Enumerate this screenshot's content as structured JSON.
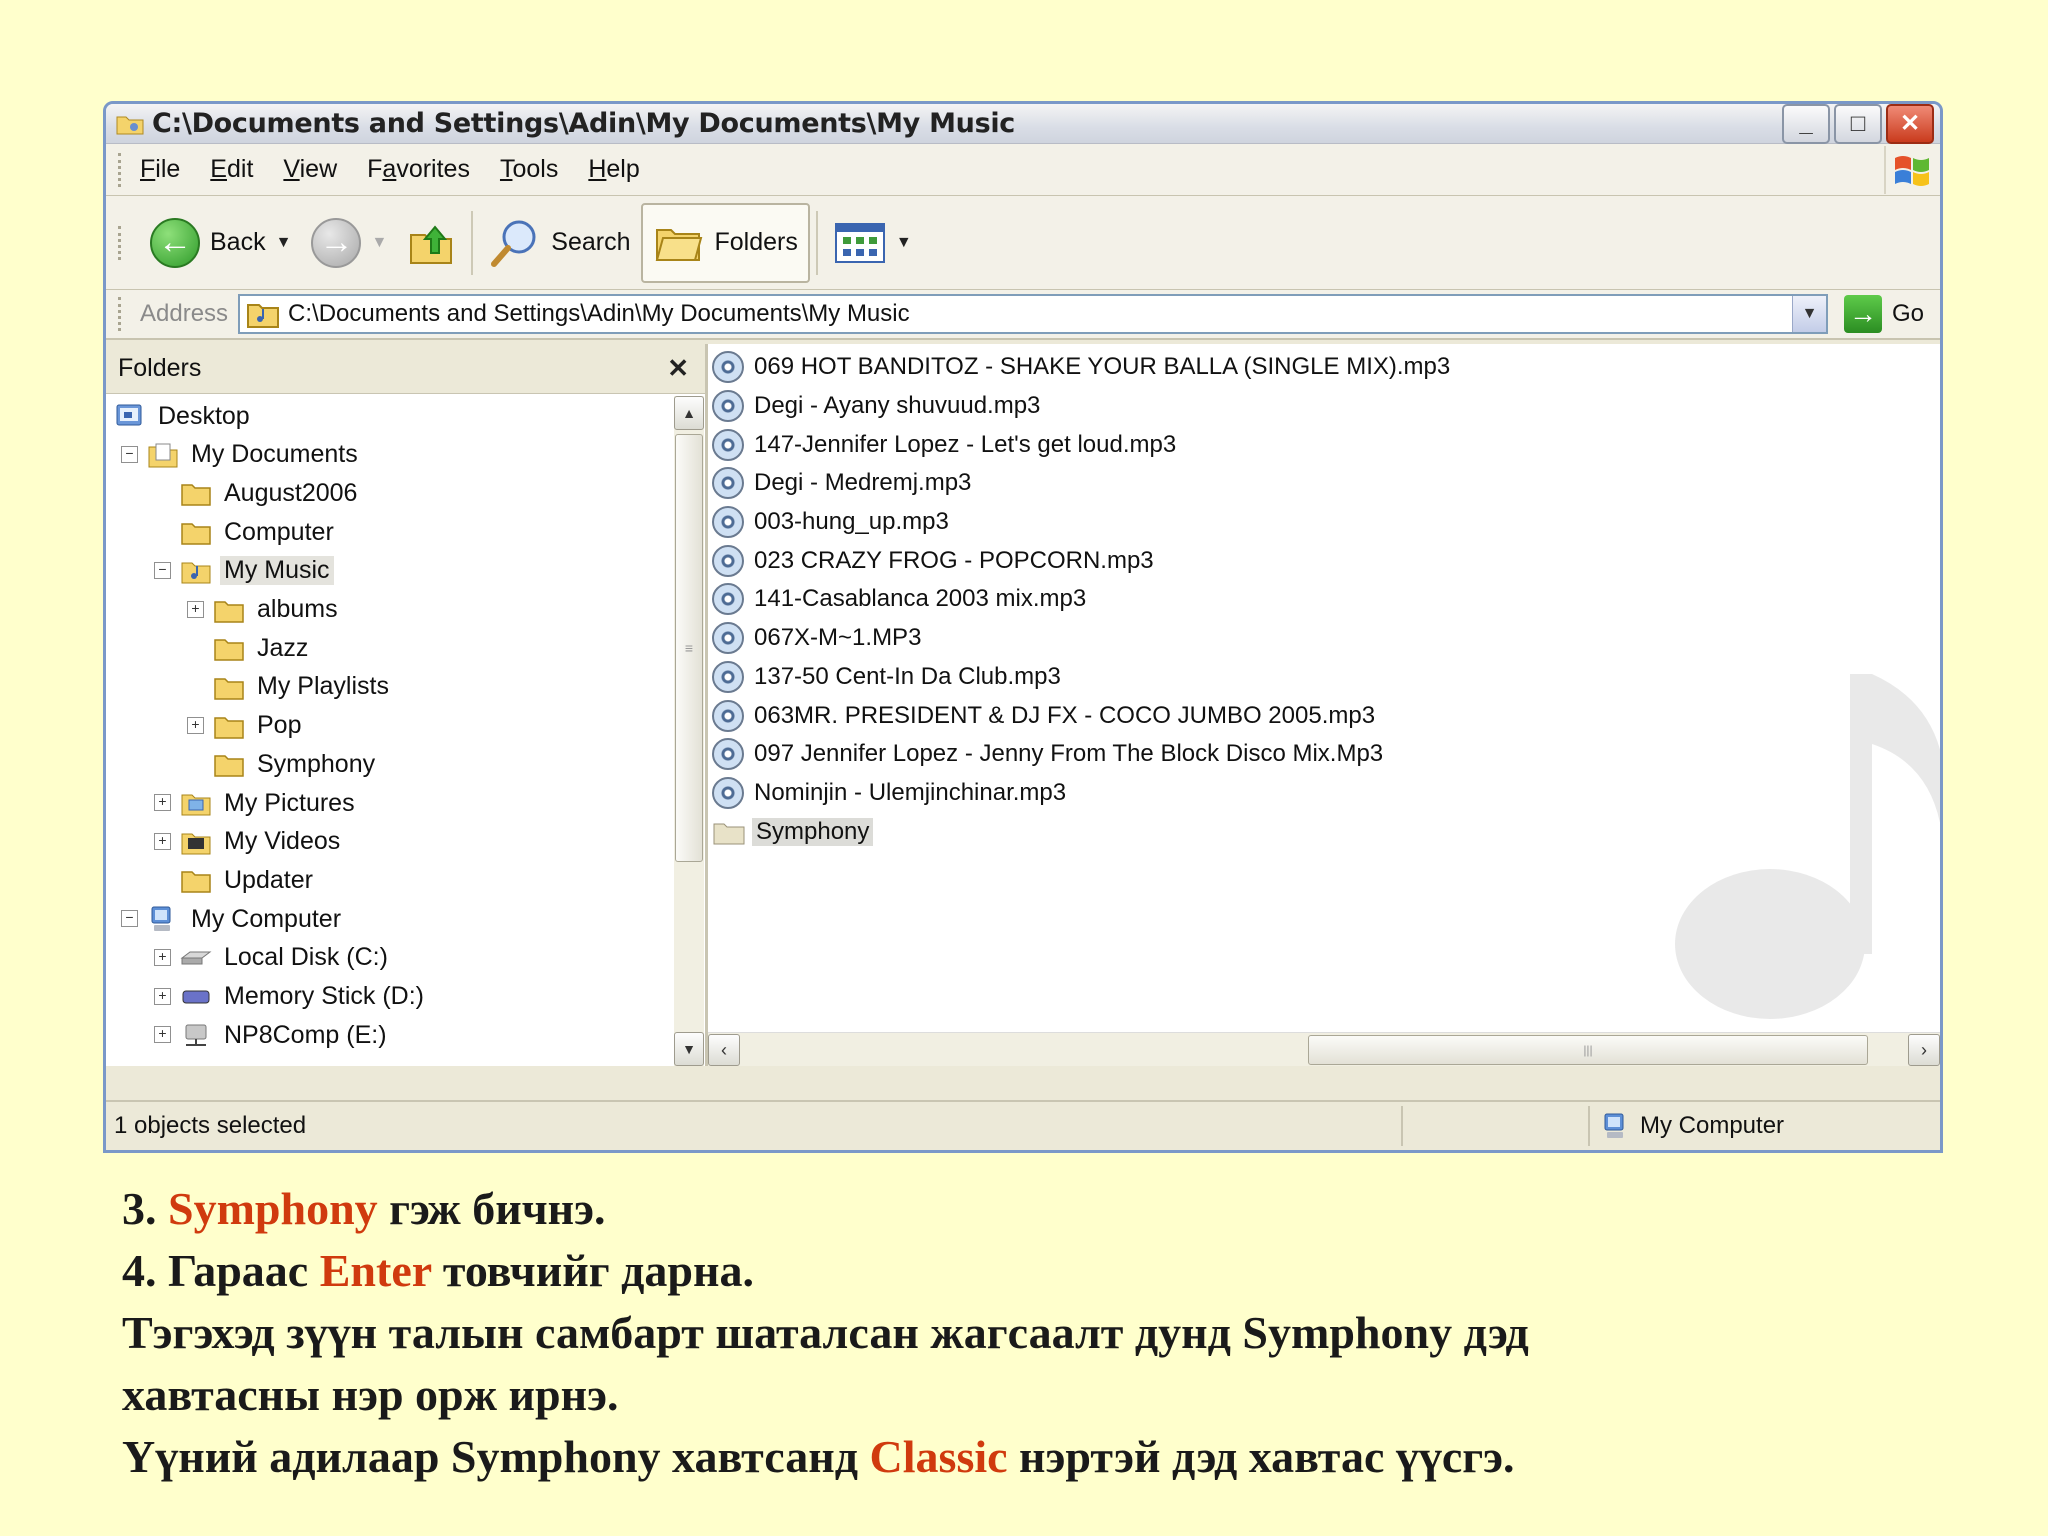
{
  "window": {
    "title": "C:\\Documents and Settings\\Adin\\My Documents\\My Music",
    "buttons": {
      "minimize": "_",
      "maximize": "□",
      "close": "✕"
    }
  },
  "menu": [
    {
      "prefix": "",
      "u": "F",
      "rest": "ile"
    },
    {
      "prefix": "",
      "u": "E",
      "rest": "dit"
    },
    {
      "prefix": "",
      "u": "V",
      "rest": "iew"
    },
    {
      "prefix": "F",
      "u": "a",
      "rest": "vorites"
    },
    {
      "prefix": "",
      "u": "T",
      "rest": "ools"
    },
    {
      "prefix": "",
      "u": "H",
      "rest": "elp"
    }
  ],
  "toolbar": {
    "back": "Back",
    "search": "Search",
    "folders": "Folders"
  },
  "address": {
    "label": "Address",
    "value": "C:\\Documents and Settings\\Adin\\My Documents\\My Music",
    "go": "Go"
  },
  "folders_pane": {
    "title": "Folders",
    "close": "✕",
    "tree": [
      {
        "label": "Desktop",
        "icon": "desktop-icon"
      },
      {
        "label": "My Documents",
        "icon": "my-documents-icon",
        "expander": "⊟"
      },
      {
        "label": "August2006",
        "icon": "folder-icon"
      },
      {
        "label": "Computer",
        "icon": "folder-icon"
      },
      {
        "label": "My Music",
        "icon": "music-folder-icon",
        "expander": "⊟",
        "selected": true
      },
      {
        "label": "albums",
        "icon": "folder-icon",
        "expander": "⊞"
      },
      {
        "label": "Jazz",
        "icon": "folder-icon"
      },
      {
        "label": "My Playlists",
        "icon": "folder-icon"
      },
      {
        "label": "Pop",
        "icon": "folder-icon",
        "expander": "⊞"
      },
      {
        "label": "Symphony",
        "icon": "folder-icon"
      },
      {
        "label": "My Pictures",
        "icon": "pictures-folder-icon",
        "expander": "⊞"
      },
      {
        "label": "My Videos",
        "icon": "videos-folder-icon",
        "expander": "⊞"
      },
      {
        "label": "Updater",
        "icon": "folder-icon"
      },
      {
        "label": "My Computer",
        "icon": "my-computer-icon",
        "expander": "⊟"
      },
      {
        "label": "Local Disk (C:)",
        "icon": "disk-icon",
        "expander": "⊞"
      },
      {
        "label": "Memory Stick (D:)",
        "icon": "memory-stick-icon",
        "expander": "⊞"
      },
      {
        "label": "NP8Comp (E:)",
        "icon": "network-drive-icon",
        "expander": "⊞"
      }
    ]
  },
  "files": [
    "069 HOT BANDITOZ - SHAKE YOUR BALLA (SINGLE MIX).mp3",
    "Degi - Ayany shuvuud.mp3",
    "147-Jennifer Lopez - Let's get loud.mp3",
    "Degi - Medremj.mp3",
    "003-hung_up.mp3",
    "023 CRAZY FROG - POPCORN.mp3",
    "141-Casablanca 2003 mix.mp3",
    "067X-M~1.MP3",
    "137-50 Cent-In Da Club.mp3",
    "063MR. PRESIDENT & DJ FX - COCO JUMBO 2005.mp3",
    "097 Jennifer Lopez - Jenny From The Block Disco Mix.Mp3",
    "Nominjin - Ulemjinchinar.mp3"
  ],
  "new_folder": "Symphony",
  "status": {
    "left": "1 objects selected",
    "right": "My Computer"
  },
  "caption": {
    "l1_pre": "3. ",
    "l1_hl": "Symphony",
    "l1_post": " гэж бичнэ.",
    "l2_pre": "4. Гараас ",
    "l2_hl": "Enter",
    "l2_post": " товчийг дарна.",
    "l3": "Тэгэхэд зүүн талын самбарт шаталсан жагсаалт дунд Symphony дэд",
    "l4": "хавтасны нэр орж ирнэ.",
    "l5_pre": "Үүний адилаар Symphony хавтсанд ",
    "l5_hl": "Classic",
    "l5_post": " нэртэй дэд хавтас үүсгэ."
  },
  "colors": {
    "highlight": "#d03a0e",
    "background": "#ffffcc"
  }
}
